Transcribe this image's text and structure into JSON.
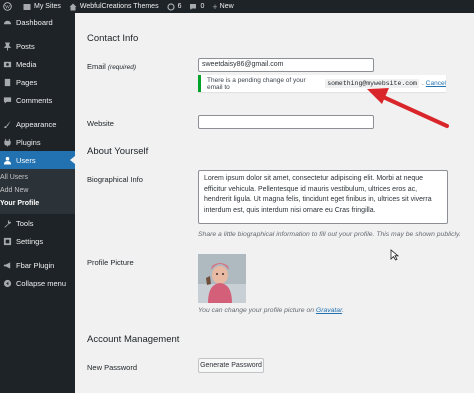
{
  "adminbar": {
    "my_sites": "My Sites",
    "site_name": "WebfulCreations Themes",
    "updates_count": "6",
    "comments_count": "0",
    "new_label": "New"
  },
  "sidebar": {
    "items": [
      {
        "label": "Dashboard",
        "icon": "dashboard-icon"
      },
      {
        "label": "Posts",
        "icon": "pin-icon"
      },
      {
        "label": "Media",
        "icon": "media-icon"
      },
      {
        "label": "Pages",
        "icon": "page-icon"
      },
      {
        "label": "Comments",
        "icon": "comment-icon"
      },
      {
        "label": "Appearance",
        "icon": "brush-icon"
      },
      {
        "label": "Plugins",
        "icon": "plugin-icon"
      },
      {
        "label": "Users",
        "icon": "users-icon"
      },
      {
        "label": "Tools",
        "icon": "wrench-icon"
      },
      {
        "label": "Settings",
        "icon": "settings-icon"
      },
      {
        "label": "Fbar Plugin",
        "icon": "megaphone-icon"
      },
      {
        "label": "Collapse menu",
        "icon": "collapse-icon"
      }
    ],
    "submenu": [
      "All Users",
      "Add New",
      "Your Profile"
    ]
  },
  "main": {
    "contact_heading": "Contact Info",
    "email_label": "Email",
    "email_required": "(required)",
    "email_value": "sweetdaisy86@gmail.com",
    "notice_text": "There is a pending change of your email to",
    "notice_email": "something@mywebsite.com",
    "notice_period": ".",
    "notice_cancel": "Cancel",
    "website_label": "Website",
    "website_value": "",
    "about_heading": "About Yourself",
    "bio_label": "Biographical Info",
    "bio_value": "Lorem ipsum dolor sit amet, consectetur adipiscing elit. Morbi at neque efficitur vehicula. Pellentesque id mauris vestibulum, ultrices eros ac, hendrerit ligula. Ut magna felis, tincidunt eget finibus in, ultrices sit viverra interdum est, quis interdum nisi ornare eu Cras fringilla.",
    "bio_desc": "Share a little biographical information to fill out your profile. This may be shown publicly.",
    "picture_label": "Profile Picture",
    "picture_desc_prefix": "You can change your profile picture on",
    "picture_desc_link": "Gravatar",
    "picture_desc_suffix": ".",
    "account_heading": "Account Management",
    "password_label": "New Password",
    "generate_button": "Generate Password"
  },
  "colors": {
    "admin_dark": "#1d2327",
    "active_blue": "#2271b1",
    "success_green": "#00a32a",
    "arrow_red": "#d9262b"
  }
}
